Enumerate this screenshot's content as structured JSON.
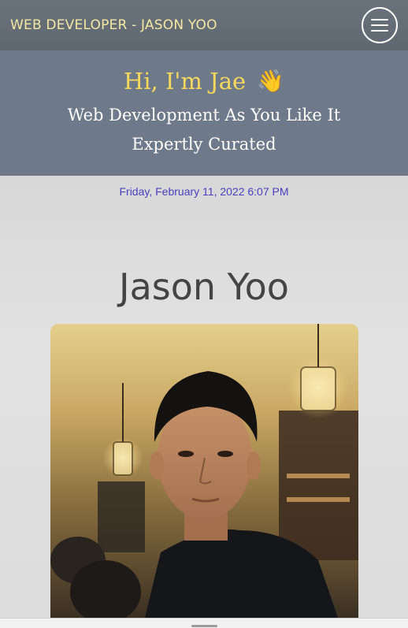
{
  "navbar": {
    "brand": "WEB DEVELOPER - JASON YOO",
    "menu_icon": "hamburger-menu-icon"
  },
  "hero": {
    "greeting": "Hi, I'm Jae",
    "wave_emoji": "👋",
    "tagline_1": "Web Development As You Like It",
    "tagline_2": "Expertly Curated"
  },
  "main": {
    "datetime": "Friday, February 11, 2022 6:07 PM",
    "name": "Jason Yoo",
    "photo_icon": "profile-photo"
  },
  "colors": {
    "navbar_bg": "#636c75",
    "brand_text": "#f3e7a3",
    "hero_bg": "#6e7a89",
    "greeting_text": "#f6d95c",
    "datetime_text": "#4b3fbf",
    "name_text": "#444444"
  }
}
